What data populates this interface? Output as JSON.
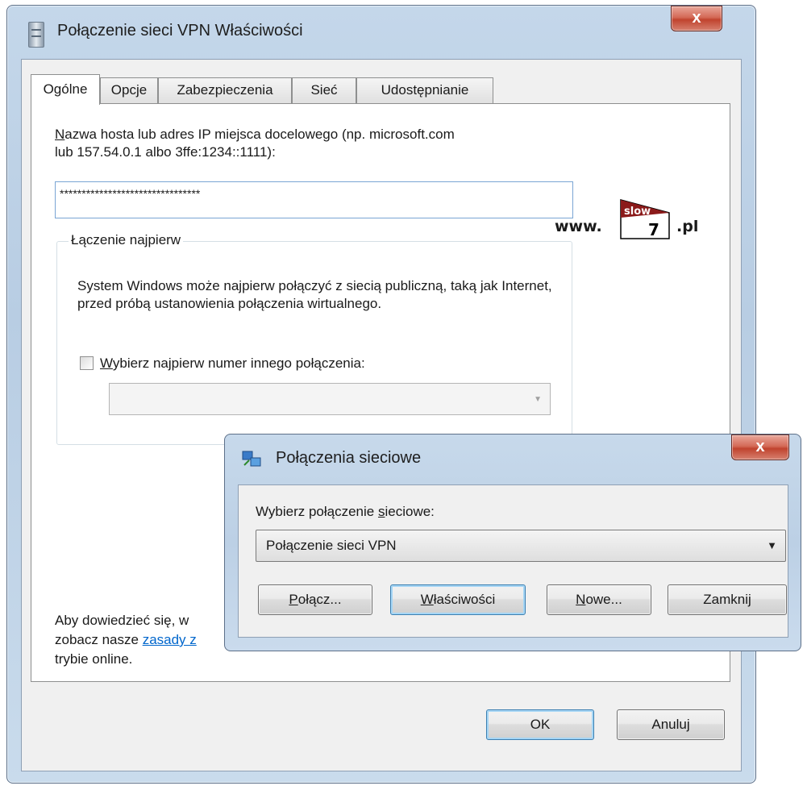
{
  "main_window": {
    "title": "Połączenie sieci VPN Właściwości",
    "close_glyph": "x",
    "tabs": [
      {
        "label": "Ogólne"
      },
      {
        "label": "Opcje"
      },
      {
        "label": "Zabezpieczenia"
      },
      {
        "label": "Sieć"
      },
      {
        "label": "Udostępnianie"
      }
    ],
    "host": {
      "label_line1_rest": "azwa hosta lub adres IP miejsca docelowego (np. microsoft.com",
      "label_line1_first": "N",
      "label_line2": "lub 157.54.0.1 albo 3ffe:1234::1111):",
      "value": "********************************"
    },
    "group": {
      "title": "Łączenie najpierw",
      "description": "System Windows może najpierw połączyć z siecią publiczną, taką jak Internet, przed próbą ustanowienia połączenia wirtualnego.",
      "checkbox_label_first": "W",
      "checkbox_label_rest": "ybierz najpierw numer innego połączenia:",
      "combo_arrow": "▼"
    },
    "info": {
      "line1": "Aby dowiedzieć się, w",
      "line2_prefix": "zobacz nasze ",
      "line2_link": "zasady z",
      "line3": "trybie online."
    },
    "buttons": {
      "ok": "OK",
      "cancel": "Anuluj"
    }
  },
  "watermark": {
    "prefix": "www.",
    "top_word": "slow",
    "number": "7",
    "suffix": ".pl"
  },
  "network_dialog": {
    "title": "Połączenia sieciowe",
    "close_glyph": "x",
    "select_label_before": "Wybierz połączenie ",
    "select_label_underlined": "s",
    "select_label_after": "ieciowe:",
    "selected_connection": "Połączenie sieci VPN",
    "combo_arrow": "▼",
    "buttons": {
      "connect_first": "P",
      "connect_rest": "ołącz...",
      "properties_first": "W",
      "properties_rest": "łaściwości",
      "new_first": "N",
      "new_rest": "owe...",
      "close": "Zamknij"
    }
  }
}
